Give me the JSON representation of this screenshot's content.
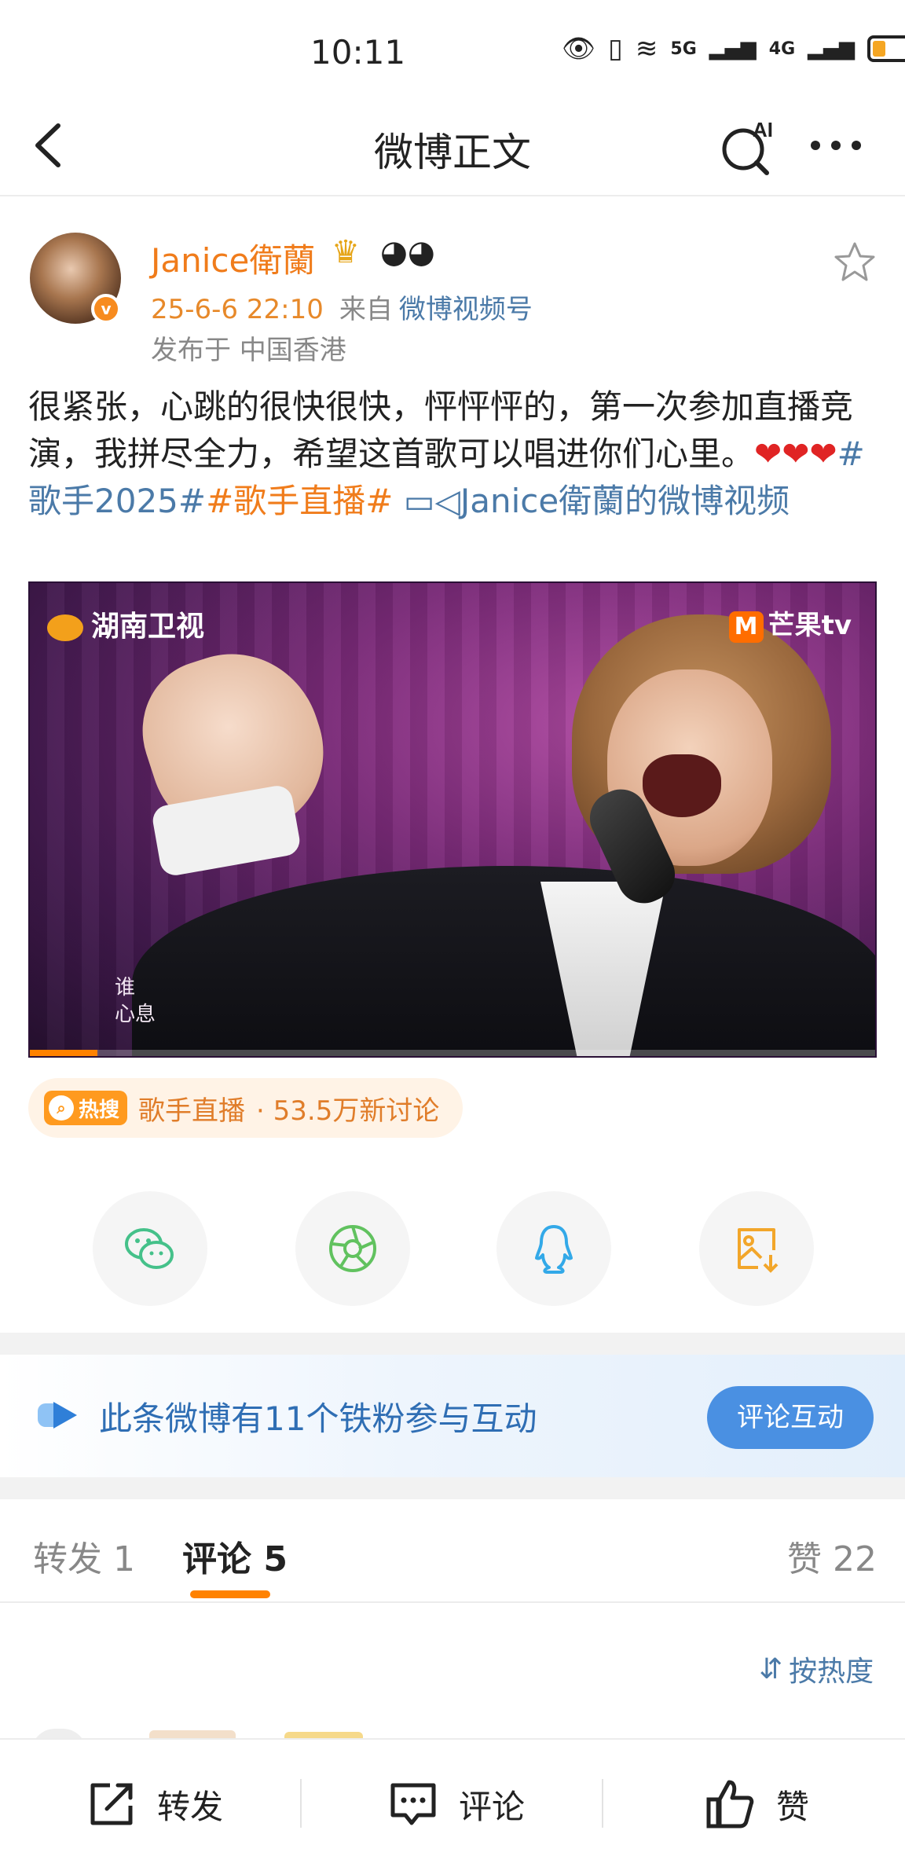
{
  "status_bar": {
    "time": "10:11",
    "network_1": "5G",
    "network_2": "4G"
  },
  "nav": {
    "title": "微博正文",
    "ai_label": "AI"
  },
  "post": {
    "author": "Janice衛蘭",
    "timestamp": "25-6-6 22:10",
    "from_prefix": "来自",
    "source": "微博视频号",
    "location": "发布于 中国香港",
    "text_main": "很紧张，心跳的很快很快，怦怦怦的，第一次参加直播竞演，我拼尽全力，希望这首歌可以唱进你们心里。",
    "tag_1": "#歌手2025#",
    "tag_2": "#歌手直播#",
    "video_link": "Janice衛蘭的微博视频",
    "video": {
      "logo_left": "湖南卫视",
      "logo_right": "芒果tv",
      "lyric": "谁 心息",
      "progress": 0.08
    }
  },
  "hot_search": {
    "badge": "热搜",
    "topic": "歌手直播",
    "count": "· 53.5万新讨论"
  },
  "share_icons": [
    "wechat-icon",
    "moments-icon",
    "qq-icon",
    "save-image-icon"
  ],
  "fan_banner": {
    "text": "此条微博有11个铁粉参与互动",
    "button": "评论互动"
  },
  "tabs": {
    "repost": "转发 1",
    "comment": "评论 5",
    "like": "赞 22"
  },
  "sort": {
    "label": "按热度"
  },
  "bottom_bar": {
    "repost": "转发",
    "comment": "评论",
    "like": "赞"
  },
  "colors": {
    "accent_orange": "#ff8200",
    "link_blue": "#4b7aa8",
    "fan_button": "#4a90e2"
  }
}
